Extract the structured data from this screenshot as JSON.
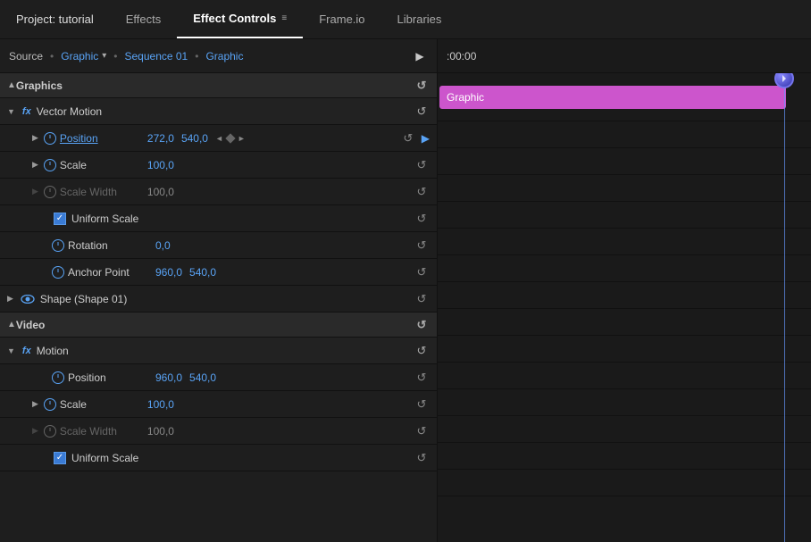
{
  "tabs": [
    {
      "id": "project",
      "label": "Project: tutorial",
      "active": false
    },
    {
      "id": "effects",
      "label": "Effects",
      "active": false
    },
    {
      "id": "effect-controls",
      "label": "Effect Controls",
      "active": true
    },
    {
      "id": "frameio",
      "label": "Frame.io",
      "active": false
    },
    {
      "id": "libraries",
      "label": "Libraries",
      "active": false
    }
  ],
  "source_bar": {
    "label": "Source",
    "separator": "•",
    "graphic_label": "Graphic",
    "sequence_label": "Sequence 01",
    "sequence_separator": "•",
    "sequence_graphic": "Graphic"
  },
  "timecode": ":00:00",
  "sections": {
    "graphics": {
      "label": "Graphics",
      "effects": [
        {
          "name": "Vector Motion",
          "properties": [
            {
              "id": "position1",
              "name": "Position",
              "active": true,
              "values": [
                "272,0",
                "540,0"
              ],
              "has_keyframe_nav": true
            },
            {
              "id": "scale1",
              "name": "Scale",
              "active": true,
              "values": [
                "100,0"
              ]
            },
            {
              "id": "scale-width1",
              "name": "Scale Width",
              "active": false,
              "values": [
                "100,0"
              ]
            },
            {
              "id": "uniform-scale1",
              "type": "checkbox",
              "label": "Uniform Scale",
              "checked": true
            },
            {
              "id": "rotation1",
              "name": "Rotation",
              "active": true,
              "values": [
                "0,0"
              ]
            },
            {
              "id": "anchor1",
              "name": "Anchor Point",
              "active": true,
              "values": [
                "960,0",
                "540,0"
              ]
            }
          ]
        }
      ],
      "shape": {
        "name": "Shape (Shape 01)"
      }
    },
    "video": {
      "label": "Video",
      "effects": [
        {
          "name": "Motion",
          "properties": [
            {
              "id": "position2",
              "name": "Position",
              "active": true,
              "values": [
                "960,0",
                "540,0"
              ]
            },
            {
              "id": "scale2",
              "name": "Scale",
              "active": true,
              "values": [
                "100,0"
              ]
            },
            {
              "id": "scale-width2",
              "name": "Scale Width",
              "active": false,
              "values": [
                "100,0"
              ]
            },
            {
              "id": "uniform-scale2",
              "type": "checkbox",
              "label": "Uniform Scale",
              "checked": true
            }
          ]
        }
      ]
    }
  },
  "timeline": {
    "graphic_label": "Graphic"
  },
  "icons": {
    "reset": "↺",
    "check": "✓",
    "expand_right": "▶",
    "expand_down": "▼",
    "play": "▶",
    "menu": "≡",
    "up": "▲",
    "right_arrow": "▶"
  }
}
